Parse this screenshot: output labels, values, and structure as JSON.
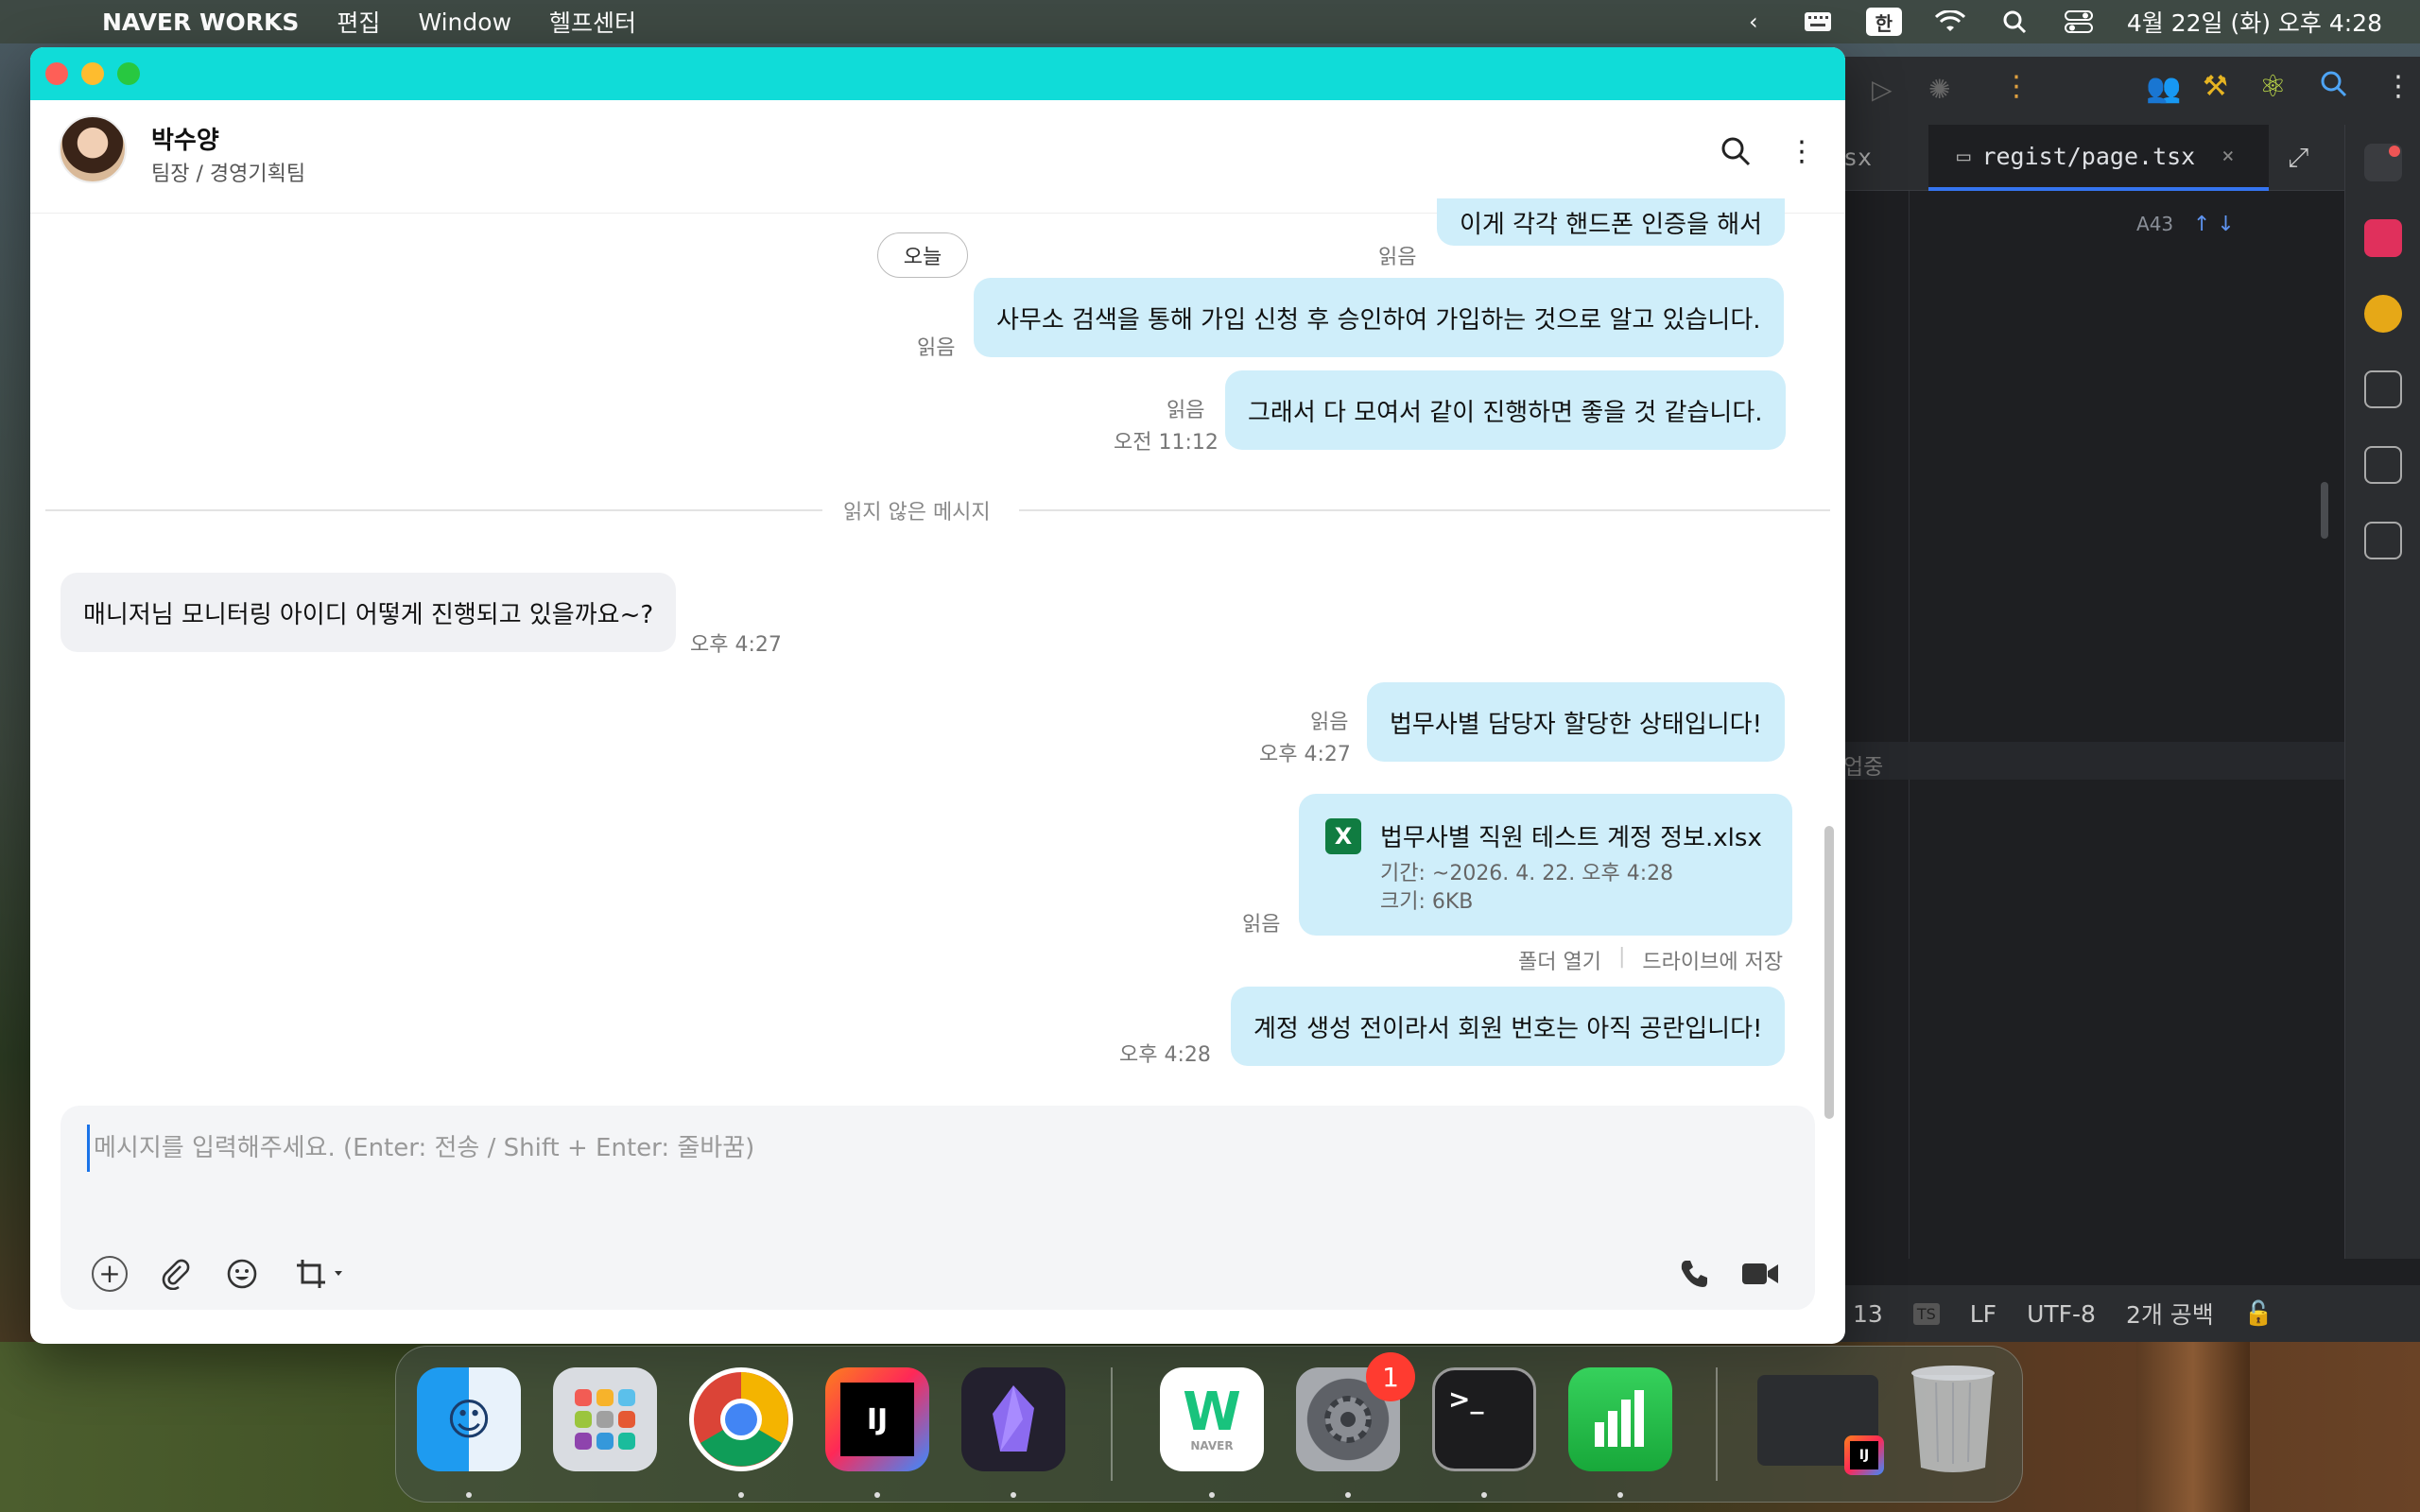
{
  "menubar": {
    "app_name": "NAVER WORKS",
    "menus": [
      "편집",
      "Window",
      "헬프센터"
    ],
    "ime": "한",
    "datetime": "4월 22일 (화) 오후 4:28"
  },
  "ide": {
    "partial_tab": "sx",
    "active_tab": "regist/page.tsx",
    "tab_close": "×",
    "match_count": "43",
    "highlight_text": "업중",
    "status": {
      "line": "13",
      "line_ending": "LF",
      "encoding": "UTF-8",
      "indent": "2개 공백"
    }
  },
  "chat": {
    "contact": {
      "name": "박수양",
      "subtitle": "팀장 / 경영기획팀"
    },
    "date_divider": "오늘",
    "unread_divider": "읽지 않은 메시지",
    "messages": [
      {
        "text": "이게 각각 핸드폰 인증을 해서",
        "read": "읽음"
      },
      {
        "text": "사무소 검색을 통해 가입 신청 후 승인하여 가입하는 것으로 알고 있습니다.",
        "read": "읽음"
      },
      {
        "text": "그래서 다 모여서 같이 진행하면 좋을 것 같습니다.",
        "read": "읽음",
        "time": "오전 11:12"
      },
      {
        "text": "매니저님 모니터링 아이디 어떻게 진행되고 있을까요~?",
        "time": "오후 4:27"
      },
      {
        "text": "법무사별 담당자 할당한 상태입니다!",
        "read": "읽음",
        "time": "오후 4:27"
      },
      {
        "text": "계정 생성 전이라서 회원 번호는 아직 공란입니다!",
        "time": "오후 4:28"
      }
    ],
    "file": {
      "name": "법무사별 직원 테스트 계정 정보.xlsx",
      "period": "기간: ~2026. 4. 22. 오후 4:28",
      "size": "크기: 6KB",
      "read": "읽음",
      "open_folder": "폴더 열기",
      "save_drive": "드라이브에 저장"
    },
    "composer": {
      "placeholder": "메시지를 입력해주세요. (Enter: 전송 / Shift + Enter: 줄바꿈)",
      "value": ""
    }
  },
  "dock": {
    "apps": [
      "Finder",
      "Launchpad",
      "Chrome",
      "IntelliJ IDEA",
      "Obsidian",
      "NAVER WORKS",
      "System Settings",
      "Terminal",
      "Numbers",
      "IntelliJ window",
      "Trash"
    ],
    "labels": {
      "idea": "IJ",
      "naver_works": "W",
      "naver_sub": "NAVER",
      "terminal": ">_"
    },
    "settings_badge": "1"
  },
  "colors": {
    "titlebar": "#10dcd8",
    "bubble_me": "#cfeefa",
    "bubble_them": "#f0f1f4",
    "excel": "#107c41"
  }
}
